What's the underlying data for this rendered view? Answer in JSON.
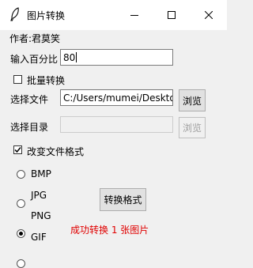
{
  "window": {
    "title": "图片转换",
    "minimize_icon": "minimize-icon",
    "maximize_icon": "maximize-icon",
    "close_icon": "close-icon"
  },
  "author": "作者:君莫笑",
  "percent": {
    "label": "输入百分比",
    "value": "80"
  },
  "batch": {
    "label": "批量转换",
    "checked": false
  },
  "select_file": {
    "label": "选择文件",
    "value": "C:/Users/mumei/Desktop",
    "browse_label": "浏览"
  },
  "select_dir": {
    "label": "选择目录",
    "value": "",
    "browse_label": "浏览"
  },
  "change_format": {
    "label": "改变文件格式",
    "checked": true
  },
  "formats": [
    {
      "label": "BMP",
      "selected": false
    },
    {
      "label": "JPG",
      "selected": false
    },
    {
      "label": "PNG",
      "selected": true
    },
    {
      "label": "GIF",
      "selected": false
    }
  ],
  "convert_button": "转换格式",
  "status": {
    "text": "成功转换 1 张图片",
    "color": "#e00000"
  }
}
